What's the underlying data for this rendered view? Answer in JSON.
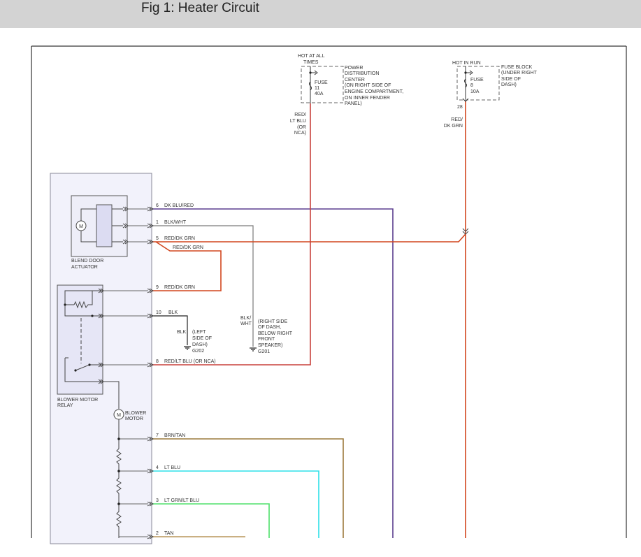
{
  "header": {
    "title": "Fig 1: Heater Circuit"
  },
  "power_distribution": {
    "hot_label": [
      "HOT AT ALL",
      "TIMES"
    ],
    "fuse_label": [
      "FUSE",
      "11",
      "40A"
    ],
    "location": [
      "POWER",
      "DISTRIBUTION",
      "CENTER",
      "(ON RIGHT SIDE OF",
      "ENGINE COMPARTMENT,",
      "ON INNER FENDER",
      "PANEL)"
    ],
    "wire_label": [
      "RED/",
      "LT BLU",
      "(OR",
      "NCA)"
    ]
  },
  "fuse_block": {
    "hot_label": "HOT IN RUN",
    "fuse_label": [
      "FUSE",
      "8",
      "10A"
    ],
    "location": [
      "FUSE BLOCK",
      "(UNDER RIGHT",
      "SIDE OF",
      "DASH)"
    ],
    "pin": "28",
    "wire_label": [
      "RED/",
      "DK GRN"
    ]
  },
  "blend_door": {
    "label": [
      "BLEND DOOR",
      "ACTUATOR"
    ],
    "motor_symbol": "M"
  },
  "relay": {
    "label": [
      "BLOWER MOTOR",
      "RELAY"
    ]
  },
  "blower_motor": {
    "label": [
      "BLOWER",
      "MOTOR"
    ],
    "motor_symbol": "M"
  },
  "pins": [
    {
      "num": "6",
      "wire": "DK BLU/RED"
    },
    {
      "num": "1",
      "wire": "BLK/WHT"
    },
    {
      "num": "5",
      "wire": "RED/DK GRN"
    },
    {
      "num": "9",
      "wire": "RED/DK GRN"
    },
    {
      "num": "10",
      "wire": "BLK"
    },
    {
      "num": "8",
      "wire": "RED/LT BLU (OR NCA)"
    },
    {
      "num": "7",
      "wire": "BRN/TAN"
    },
    {
      "num": "4",
      "wire": "LT BLU"
    },
    {
      "num": "3",
      "wire": "LT GRN/LT BLU"
    },
    {
      "num": "2",
      "wire": "TAN"
    }
  ],
  "jumper_label": "RED/DK GRN",
  "ground_g202": {
    "wire": "BLK",
    "location": [
      "(LEFT",
      "SIDE OF",
      "DASH)"
    ],
    "name": "G202"
  },
  "ground_g201": {
    "wire": [
      "BLK/",
      "WHT"
    ],
    "location": [
      "(RIGHT SIDE",
      "OF DASH,",
      "BELOW RIGHT",
      "FRONT",
      "SPEAKER)"
    ],
    "name": "G201"
  },
  "colors": {
    "dk_blu_red": "#5b3f8f",
    "blk_wht": "#7a7a7a",
    "red_dk_grn": "#d2461e",
    "blk": "#222222",
    "red_lt_blu": "#c8413c",
    "brn_tan": "#9c7a3c",
    "lt_blu": "#2ee0e8",
    "lt_grn_lt_blu": "#4ee06a",
    "tan": "#b8955a"
  }
}
